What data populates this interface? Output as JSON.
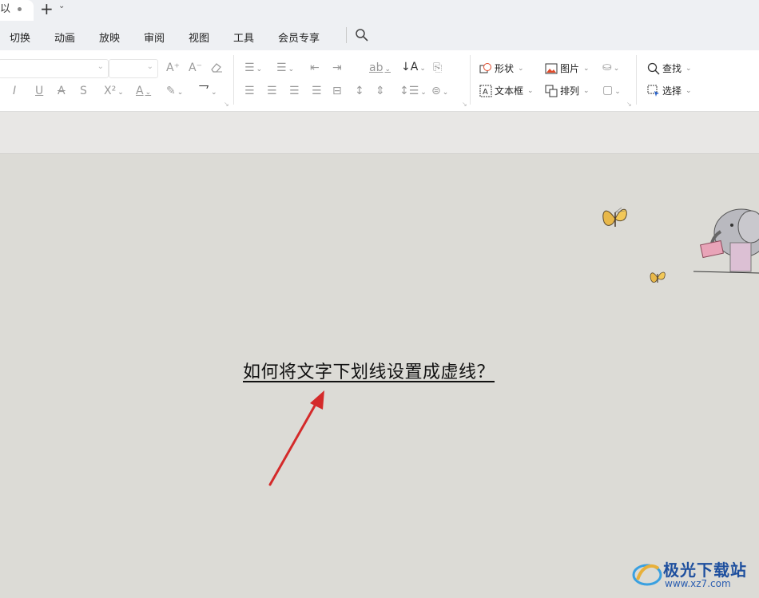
{
  "tabbar": {
    "doc_tab_name": "以",
    "new_tab": "+",
    "new_tab_caret": "⌄"
  },
  "menu": {
    "items": [
      "切换",
      "动画",
      "放映",
      "审阅",
      "视图",
      "工具",
      "会员专享"
    ]
  },
  "ribbon": {
    "shape_label": "形状",
    "picture_label": "图片",
    "textbox_label": "文本框",
    "arrange_label": "排列",
    "find_label": "查找",
    "select_label": "选择"
  },
  "document": {
    "text": "如何将文字下划线设置成虚线？"
  },
  "watermark": {
    "title": "极光下载站",
    "url": "www.xz7.com"
  },
  "colors": {
    "accent_red": "#d42a2a",
    "brand_blue": "#1e4f9e"
  }
}
